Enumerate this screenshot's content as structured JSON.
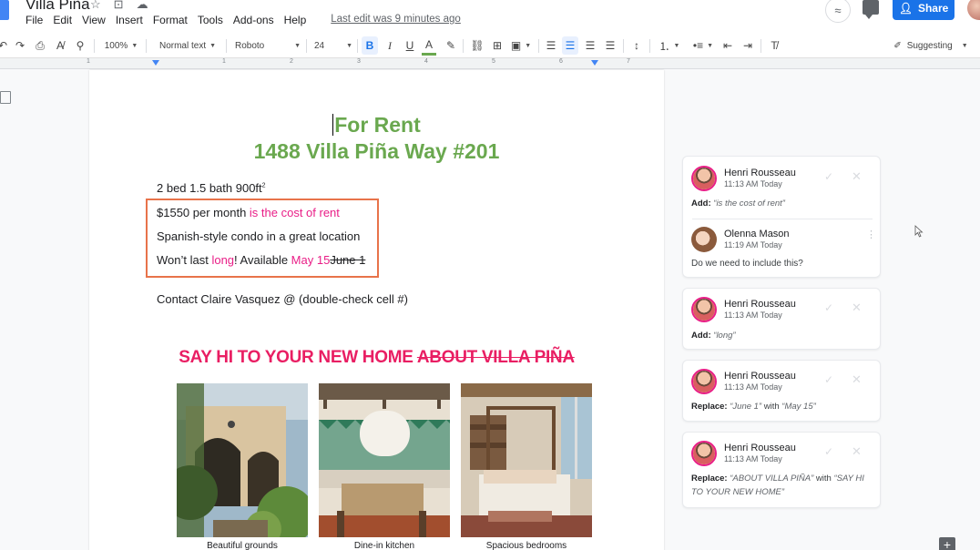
{
  "app": {
    "doc_title": "Villa Piña",
    "menu": [
      "File",
      "Edit",
      "View",
      "Insert",
      "Format",
      "Tools",
      "Add-ons",
      "Help"
    ],
    "last_edit": "Last edit was 9 minutes ago",
    "share_label": "Share"
  },
  "toolbar": {
    "zoom": "100%",
    "style": "Normal text",
    "font": "Roboto",
    "size": "24",
    "mode": "Suggesting"
  },
  "ruler": {
    "numbers": [
      "1",
      "1",
      "2",
      "3",
      "4",
      "5",
      "6",
      "7"
    ]
  },
  "document": {
    "title_line1": "For Rent",
    "title_line2": "1488 Villa Piña Way #201",
    "line1_text": "2 bed 1.5 bath 900ft",
    "line1_sup": "2",
    "line2_text": "$1550 per month ",
    "line2_sug": "is the cost of rent",
    "line3_text": "Spanish-style condo in a great location",
    "line4_a": "Won’t last ",
    "line4_sug1": "long",
    "line4_b": "! Available ",
    "line4_sug2": "May 15",
    "line4_strike": "June 1",
    "line5_text": "Contact Claire Vasquez @ (double-check cell #)",
    "heading_new": "SAY HI TO YOUR NEW HOME ",
    "heading_old": "ABOUT VILLA PIÑA",
    "photos": [
      {
        "caption": "Beautiful grounds"
      },
      {
        "caption": "Dine-in kitchen"
      },
      {
        "caption": "Spacious bedrooms"
      }
    ]
  },
  "comments": [
    {
      "name": "Henri Rousseau",
      "time": "11:13 AM Today",
      "kind": "Add:",
      "detail": "“is the cost of rent”"
    },
    {
      "name": "Olenna Mason",
      "time": "11:19 AM Today",
      "text": "Do we need to include this?"
    },
    {
      "name": "Henri Rousseau",
      "time": "11:13 AM Today",
      "kind": "Add:",
      "detail": "“long”"
    },
    {
      "name": "Henri Rousseau",
      "time": "11:13 AM Today",
      "kind": "Replace:",
      "detail": "“June 1”",
      "with": " with ",
      "detail2": "“May 15”"
    },
    {
      "name": "Henri Rousseau",
      "time": "11:13 AM Today",
      "kind": "Replace:",
      "detail": "“ABOUT VILLA PIÑA”",
      "with": " with ",
      "detail2": "“SAY HI",
      "detail3": "TO YOUR NEW HOME”"
    }
  ],
  "colors": {
    "title_green": "#6aa84f",
    "suggestion_pink": "#e91e87",
    "heading_pink": "#e91e63",
    "highlight_orange": "#e8734a",
    "share_blue": "#1a73e8"
  }
}
